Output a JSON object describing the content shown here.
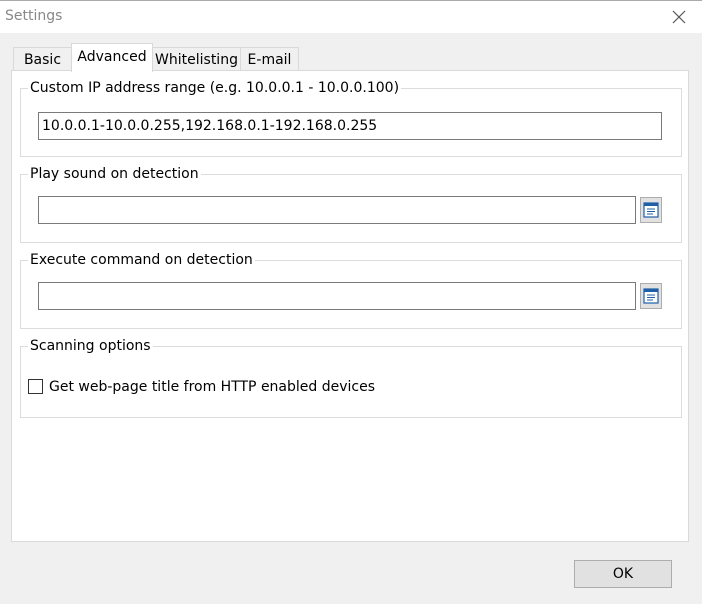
{
  "window": {
    "title": "Settings"
  },
  "tabs": [
    {
      "label": "Basic",
      "selected": false
    },
    {
      "label": "Advanced",
      "selected": true
    },
    {
      "label": "Whitelisting",
      "selected": false
    },
    {
      "label": "E-mail",
      "selected": false
    }
  ],
  "groups": {
    "ip_range": {
      "label": "Custom IP address range (e.g. 10.0.0.1 - 10.0.0.100)",
      "value": "10.0.0.1-10.0.0.255,192.168.0.1-192.168.0.255"
    },
    "play_sound": {
      "label": "Play sound on detection",
      "value": ""
    },
    "execute_command": {
      "label": "Execute command on detection",
      "value": ""
    },
    "scanning": {
      "label": "Scanning options",
      "checkbox_label": "Get web-page title from HTTP enabled devices",
      "checked": false
    }
  },
  "buttons": {
    "ok": "OK"
  },
  "icons": {
    "close": "close-icon",
    "browse": "browse-file-icon"
  }
}
